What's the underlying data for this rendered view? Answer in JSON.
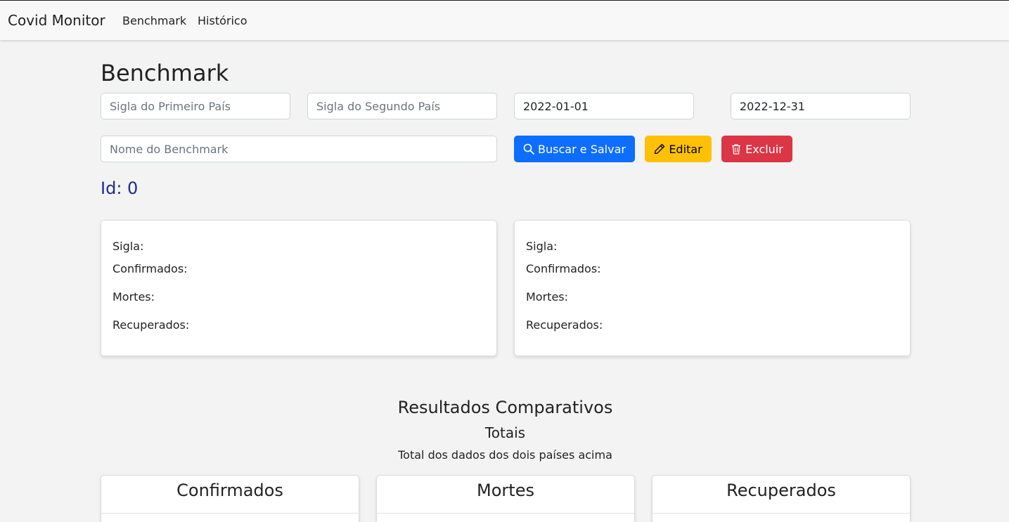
{
  "nav": {
    "brand": "Covid Monitor",
    "links": [
      "Benchmark",
      "Histórico"
    ]
  },
  "page": {
    "title": "Benchmark"
  },
  "form": {
    "first_country_placeholder": "Sigla do Primeiro País",
    "second_country_placeholder": "Sigla do Segundo País",
    "start_date": "2022-01-01",
    "end_date": "2022-12-31",
    "benchmark_name_placeholder": "Nome do Benchmark"
  },
  "buttons": {
    "search_save": "Buscar e Salvar",
    "edit": "Editar",
    "delete": "Excluir"
  },
  "id_label": "Id: 0",
  "country_cards": [
    {
      "sigla": "Sigla:",
      "confirmados": "Confirmados:",
      "mortes": "Mortes:",
      "recuperados": "Recuperados:"
    },
    {
      "sigla": "Sigla:",
      "confirmados": "Confirmados:",
      "mortes": "Mortes:",
      "recuperados": "Recuperados:"
    }
  ],
  "results": {
    "title": "Resultados Comparativos",
    "subtitle": "Totais",
    "description": "Total dos dados dos dois países acima",
    "cards": [
      "Confirmados",
      "Mortes",
      "Recuperados"
    ]
  },
  "colors": {
    "primary": "#0d6efd",
    "warning": "#ffc107",
    "danger": "#dc3545",
    "id_text": "#1f2a8a",
    "background": "#f3f3f3"
  },
  "icons": {
    "search": "search-icon",
    "edit": "pencil-icon",
    "delete": "trash-icon"
  }
}
